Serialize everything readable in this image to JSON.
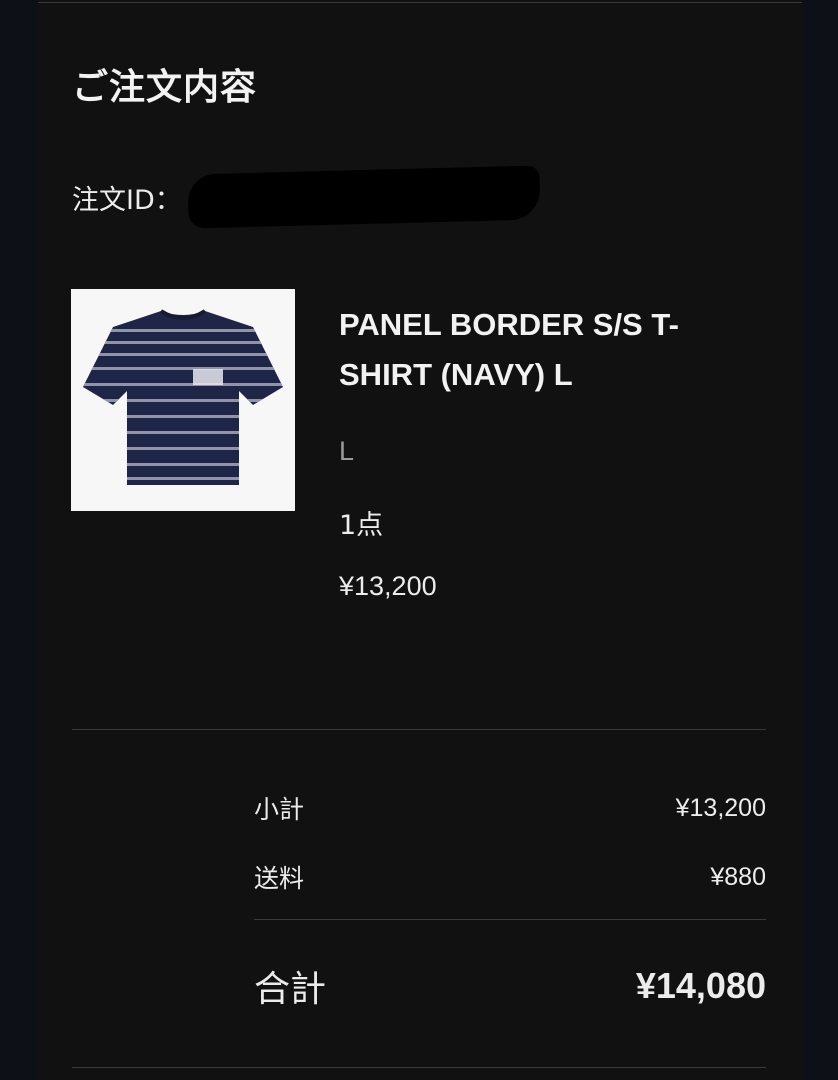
{
  "order": {
    "title": "ご注文内容",
    "id_label": "注文ID："
  },
  "item": {
    "image_icon": "tshirt-image",
    "name": "PANEL BORDER S/S T-SHIRT (NAVY) L",
    "variant": "L",
    "quantity": "1点",
    "price": "¥13,200"
  },
  "summary": {
    "subtotal_label": "小計",
    "subtotal_value": "¥13,200",
    "shipping_label": "送料",
    "shipping_value": "¥880",
    "total_label": "合計",
    "total_value": "¥14,080"
  },
  "colors": {
    "background": "#111111",
    "text": "#ececec",
    "muted": "#9a9a9a",
    "divider": "#3a3a3a",
    "shirt_navy": "#1f2547"
  }
}
